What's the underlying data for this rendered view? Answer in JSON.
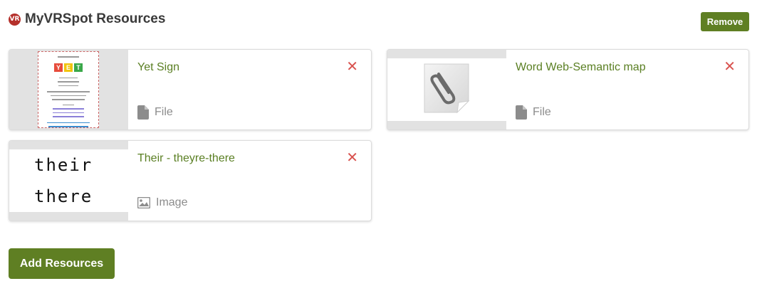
{
  "header": {
    "brand_icon_text": "VR",
    "title": "MyVRSpot Resources",
    "remove_label": "Remove"
  },
  "resources": [
    {
      "title": "Yet Sign",
      "type_label": "File",
      "type_icon": "file-icon",
      "thumbnail": "yet-sign-document"
    },
    {
      "title": "Word Web-Semantic map",
      "type_label": "File",
      "type_icon": "file-icon",
      "thumbnail": "paperclip-icon"
    },
    {
      "title": "Their - theyre-there",
      "type_label": "Image",
      "type_icon": "image-icon",
      "thumbnail": "their-there-words",
      "thumbnail_words": [
        "their",
        "there"
      ]
    }
  ],
  "close_glyph": "✕",
  "yet_sign_letters": [
    "Y",
    "E",
    "T"
  ],
  "add_label": "Add Resources",
  "colors": {
    "accent": "#5f7f23",
    "title_green": "#5a7f23",
    "close_red": "#d9534f",
    "brand_red": "#b5302b"
  }
}
